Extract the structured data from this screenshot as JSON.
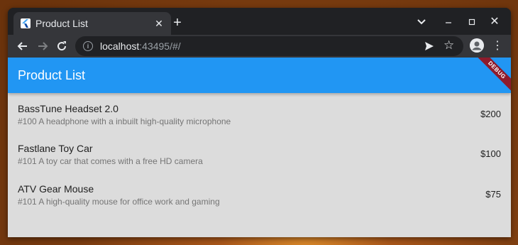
{
  "browser": {
    "tab_title": "Product List",
    "url_host": "localhost",
    "url_rest": ":43495/#/"
  },
  "app": {
    "title": "Product List",
    "debug_label": "DEBUG",
    "accent_color": "#2196f3"
  },
  "products": [
    {
      "name": "BassTune Headset 2.0",
      "description": "#100 A headphone with a inbuilt high-quality microphone",
      "price": "$200"
    },
    {
      "name": "Fastlane Toy Car",
      "description": "#101 A toy car that comes with a free HD camera",
      "price": "$100"
    },
    {
      "name": "ATV Gear Mouse",
      "description": "#101 A high-quality mouse for office work and gaming",
      "price": "$75"
    }
  ]
}
